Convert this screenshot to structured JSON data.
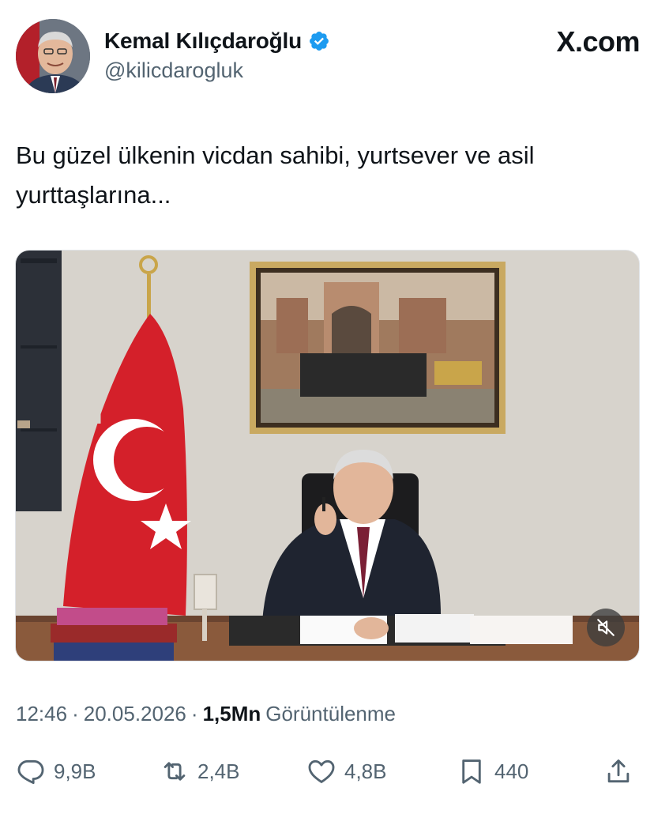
{
  "author": {
    "name": "Kemal Kılıçdaroğlu",
    "handle": "@kilicdarogluk",
    "verified": true
  },
  "site_label": "X.com",
  "tweet": {
    "text": "Bu güzel ülkenin vicdan sahibi, yurtsever ve asil yurttaşlarına..."
  },
  "media": {
    "type": "video",
    "mute_icon": "muted-speaker-icon"
  },
  "meta": {
    "time": "12:46",
    "separator": "·",
    "date": "20.05.2026",
    "views_count": "1,5Mn",
    "views_label": "Görüntülenme"
  },
  "actions": {
    "replies": "9,9B",
    "reposts": "2,4B",
    "likes": "4,8B",
    "bookmarks": "440"
  },
  "colors": {
    "text_primary": "#0f1419",
    "text_secondary": "#536471",
    "verified": "#1d9bf0",
    "flag_red": "#e30a17"
  }
}
